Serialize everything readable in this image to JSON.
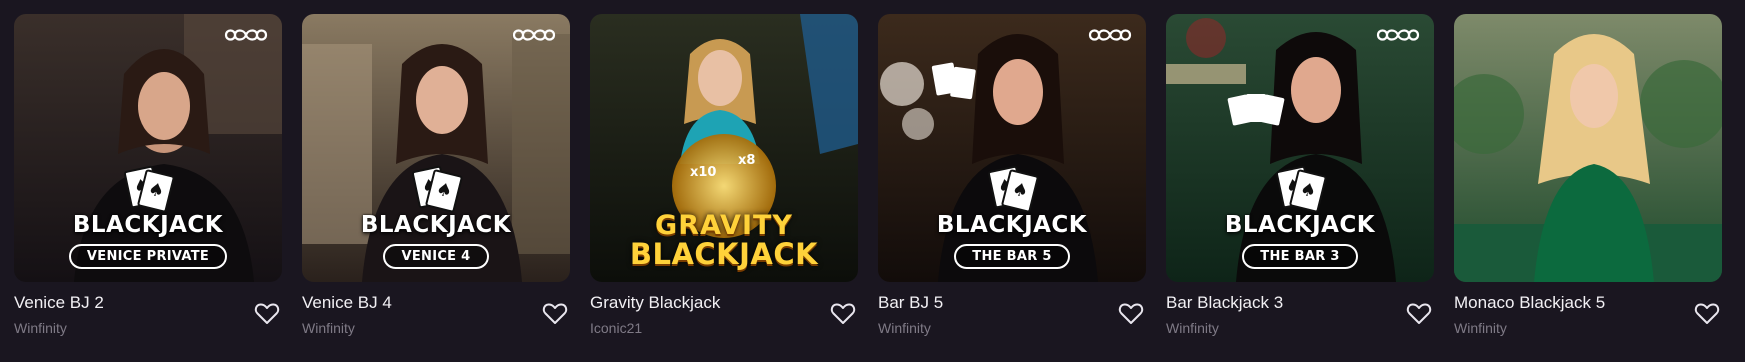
{
  "games": [
    {
      "title": "Venice BJ 2",
      "provider": "Winfinity",
      "logo_text": "BLACKJACK",
      "pill": "VENICE PRIVATE",
      "favorite_icon": "heart-outline-icon",
      "badge_icon": "infinity-icon",
      "bg": [
        "#3a2f2a",
        "#141014"
      ]
    },
    {
      "title": "Venice BJ 4",
      "provider": "Winfinity",
      "logo_text": "BLACKJACK",
      "pill": "VENICE 4",
      "favorite_icon": "heart-outline-icon",
      "badge_icon": "infinity-icon",
      "bg": [
        "#8a7a62",
        "#2a211c"
      ]
    },
    {
      "title": "Gravity Blackjack",
      "provider": "Iconic21",
      "logo_line1": "GRAVITY",
      "logo_line2": "BLACKJACK",
      "multipliers": [
        "x10",
        "x8"
      ],
      "favorite_icon": "heart-outline-icon",
      "bg": [
        "#2a2e20",
        "#0c0e0a"
      ]
    },
    {
      "title": "Bar BJ 5",
      "provider": "Winfinity",
      "logo_text": "BLACKJACK",
      "pill": "THE BAR 5",
      "favorite_icon": "heart-outline-icon",
      "badge_icon": "infinity-icon",
      "bg": [
        "#3c2a1c",
        "#120c0a"
      ]
    },
    {
      "title": "Bar Blackjack 3",
      "provider": "Winfinity",
      "logo_text": "BLACKJACK",
      "pill": "THE BAR 3",
      "favorite_icon": "heart-outline-icon",
      "badge_icon": "infinity-icon",
      "bg": [
        "#2a4a34",
        "#0e2418"
      ]
    },
    {
      "title": "Monaco Blackjack 5",
      "provider": "Winfinity",
      "favorite_icon": "heart-outline-icon",
      "bg": [
        "#7e8a6a",
        "#1e4a2c"
      ]
    }
  ],
  "colors": {
    "page_bg": "#1a1620",
    "title": "#f2f0f4",
    "provider": "#7f7a86",
    "gravity_gold": "#ffd23a"
  }
}
